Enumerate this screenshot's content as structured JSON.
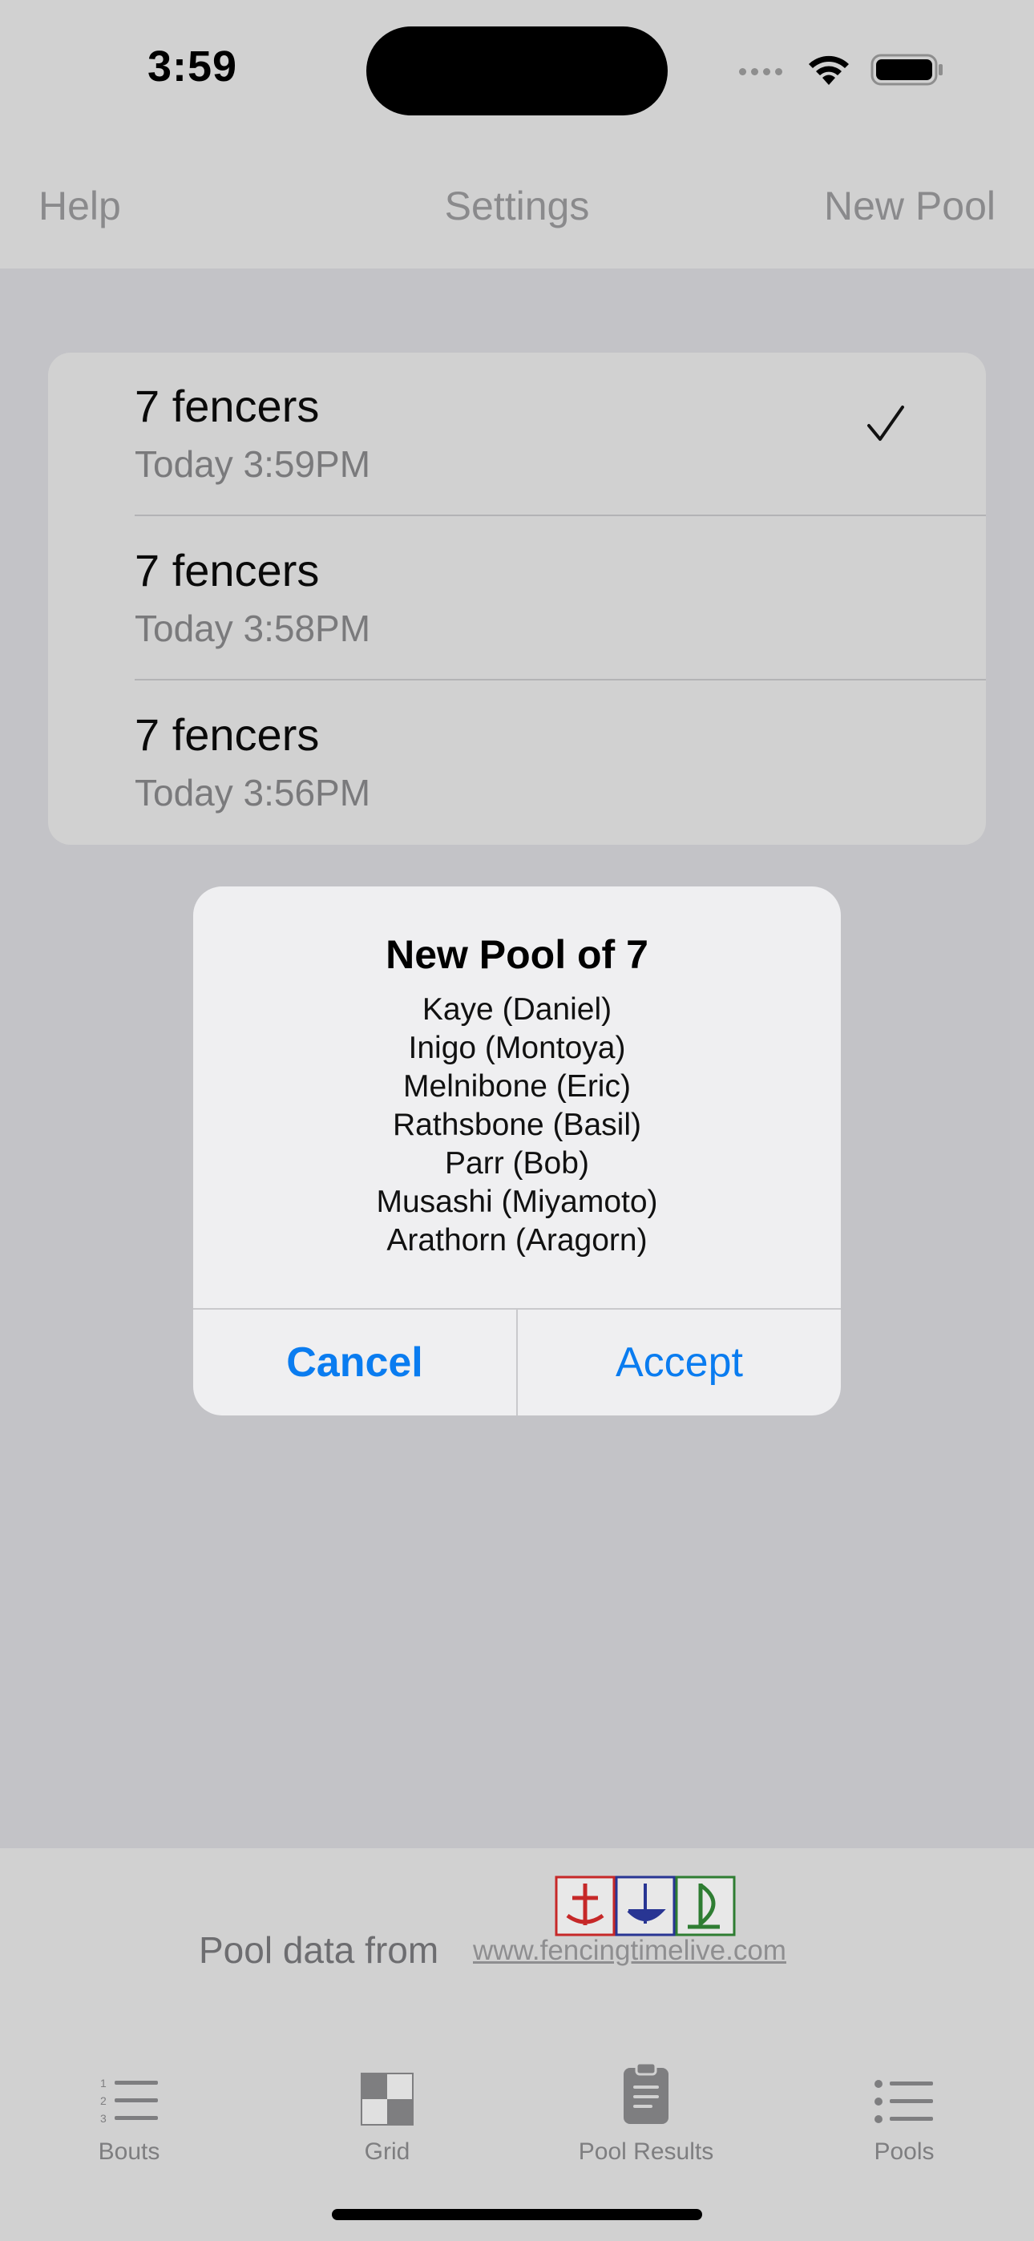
{
  "status_bar": {
    "time": "3:59"
  },
  "navbar": {
    "help_label": "Help",
    "settings_label": "Settings",
    "new_pool_label": "New Pool"
  },
  "pools_list": [
    {
      "title": "7 fencers",
      "subtitle": "Today 3:59PM",
      "selected": true
    },
    {
      "title": "7 fencers",
      "subtitle": "Today 3:58PM",
      "selected": false
    },
    {
      "title": "7 fencers",
      "subtitle": "Today 3:56PM",
      "selected": false
    }
  ],
  "alert": {
    "title": "New Pool of 7",
    "fencers": [
      "Kaye (Daniel)",
      "Inigo (Montoya)",
      "Melnibone (Eric)",
      "Rathsbone (Basil)",
      "Parr (Bob)",
      "Musashi (Miyamoto)",
      "Arathorn (Aragorn)"
    ],
    "cancel_label": "Cancel",
    "accept_label": "Accept"
  },
  "footer": {
    "pool_data_from": "Pool data from",
    "link_text": "www.fencingtimelive.com"
  },
  "tabs": [
    {
      "label": "Bouts",
      "icon": "numbered-list-icon"
    },
    {
      "label": "Grid",
      "icon": "grid-icon"
    },
    {
      "label": "Pool Results",
      "icon": "clipboard-icon"
    },
    {
      "label": "Pools",
      "icon": "list-icon"
    }
  ],
  "colors": {
    "accent": "#0a7cf0",
    "dim_background": "#c3c3c7",
    "alert_background": "#efeff1",
    "logo_red": "#c62828",
    "logo_blue": "#283593",
    "logo_green": "#2e7d32"
  }
}
